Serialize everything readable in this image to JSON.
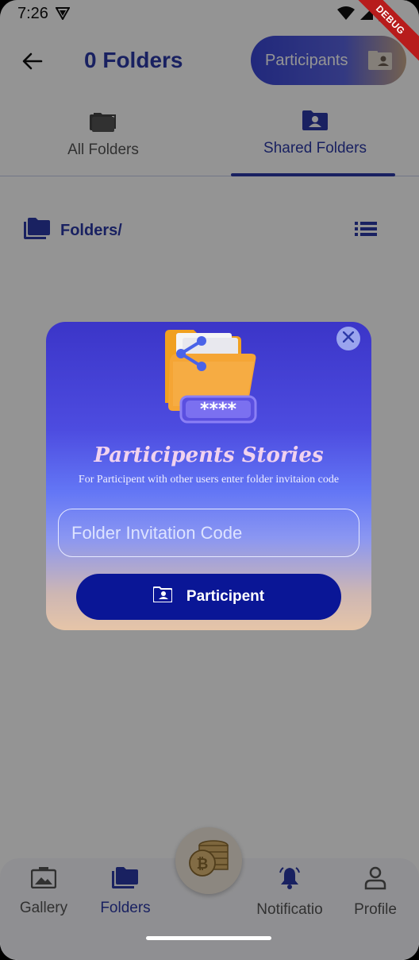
{
  "status_bar": {
    "time": "7:26",
    "debug_label": "DEBUG"
  },
  "app_bar": {
    "title": "0 Folders",
    "participants_label": "Participants"
  },
  "tabs": [
    {
      "label": "All Folders",
      "icon": "folders-icon"
    },
    {
      "label": "Shared Folders",
      "icon": "shared-folder-icon",
      "active": true
    }
  ],
  "breadcrumb": {
    "path": "Folders/"
  },
  "dialog": {
    "title": "Participents Stories",
    "subtitle": "For Participent with other users enter folder invitaion code",
    "input_placeholder": "Folder Invitation Code",
    "button_label": "Participent",
    "code_mask": "****"
  },
  "bottom_nav": [
    {
      "label": "Gallery",
      "icon": "gallery-icon"
    },
    {
      "label": "Folders",
      "icon": "folder-icon",
      "active": true
    },
    {
      "label": "Notificatio",
      "icon": "bell-icon"
    },
    {
      "label": "Profile",
      "icon": "profile-icon"
    }
  ],
  "colors": {
    "primary": "#2c3aa8",
    "button_dark": "#0a1696",
    "dialog_top": "#3b35c8",
    "dialog_bottom": "#e6c5a8"
  }
}
